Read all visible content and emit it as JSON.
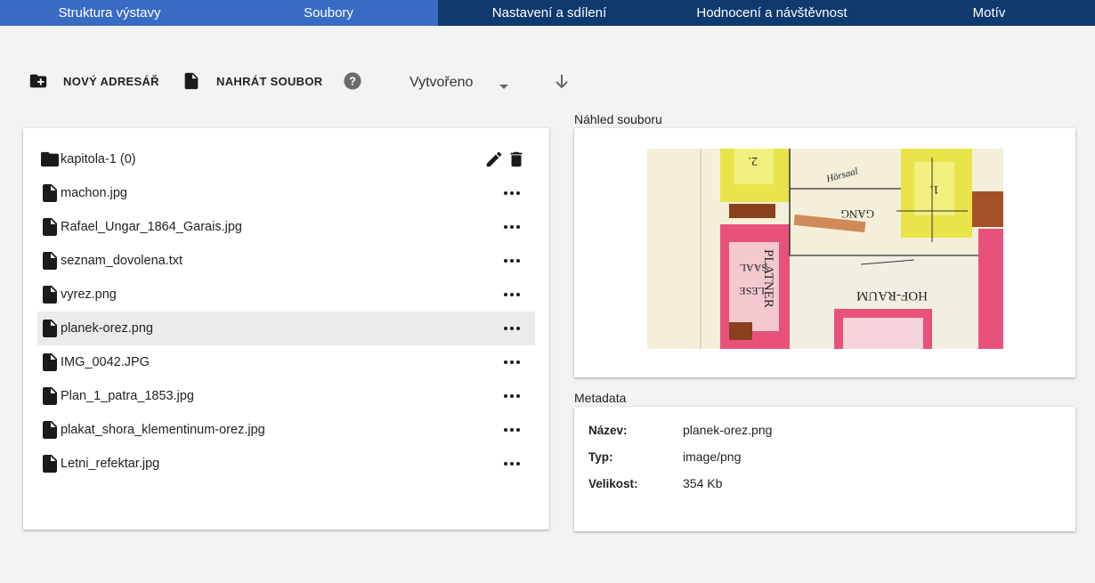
{
  "tabs": [
    {
      "label": "Struktura výstavy"
    },
    {
      "label": "Soubory"
    },
    {
      "label": "Nastavení a sdílení"
    },
    {
      "label": "Hodnocení a návštěvnost"
    },
    {
      "label": "Motív"
    }
  ],
  "toolbar": {
    "new_folder_label": "NOVÝ ADRESÁŘ",
    "upload_label": "NAHRÁT SOUBOR",
    "sort_value": "Vytvořeno"
  },
  "files": [
    {
      "name": "kapitola-1 (0)",
      "type": "folder"
    },
    {
      "name": "machon.jpg",
      "type": "file"
    },
    {
      "name": "Rafael_Ungar_1864_Garais.jpg",
      "type": "file"
    },
    {
      "name": "seznam_dovolena.txt",
      "type": "file"
    },
    {
      "name": "vyrez.png",
      "type": "file"
    },
    {
      "name": "planek-orez.png",
      "type": "file",
      "selected": true
    },
    {
      "name": "IMG_0042.JPG",
      "type": "file"
    },
    {
      "name": "Plan_1_patra_1853.jpg",
      "type": "file"
    },
    {
      "name": "plakat_shora_klementinum-orez.jpg",
      "type": "file"
    },
    {
      "name": "Letni_refektar.jpg",
      "type": "file"
    }
  ],
  "preview": {
    "title": "Náhled souboru",
    "map_labels": [
      "PLATNER",
      "GANG",
      "HOF-RAUM",
      "SAAL",
      "LESE",
      "Hörsaal",
      "2.",
      "1."
    ]
  },
  "metadata": {
    "title": "Metadata",
    "rows": [
      {
        "key": "Název:",
        "value": "planek-orez.png"
      },
      {
        "key": "Typ:",
        "value": "image/png"
      },
      {
        "key": "Velikost:",
        "value": "354 Kb"
      }
    ]
  },
  "colors": {
    "tab_active": "#3a6bc4",
    "tab_inactive": "#0e3a6e",
    "selected_row": "#ebebeb"
  }
}
